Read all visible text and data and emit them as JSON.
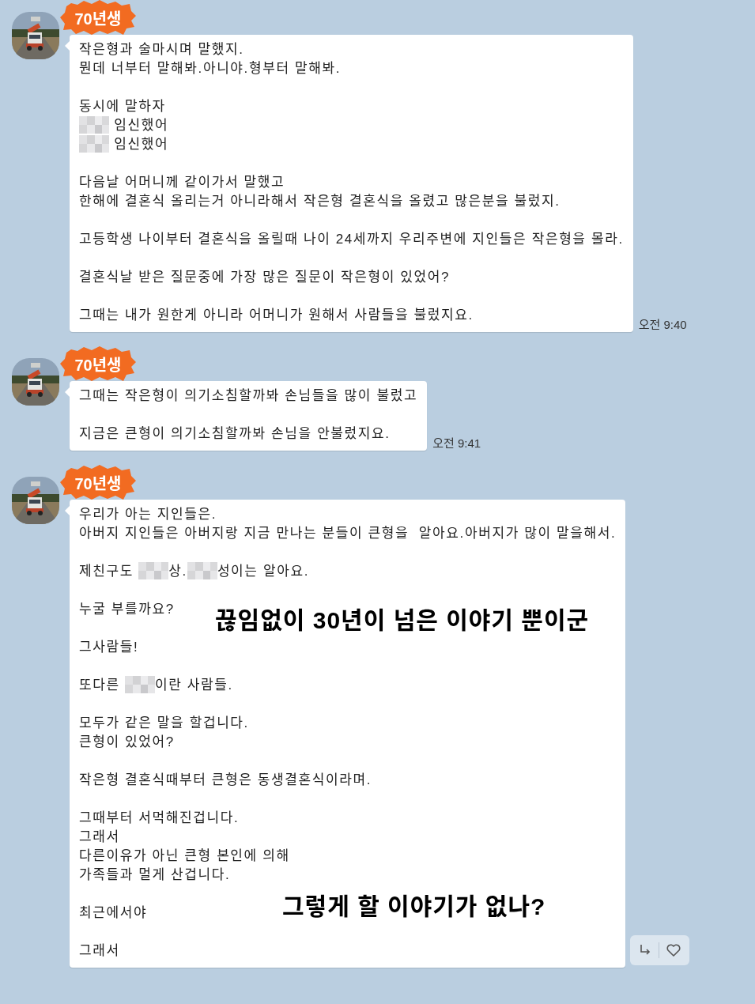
{
  "messages": [
    {
      "sender": "70년생",
      "time": "오전 9:40",
      "paragraphs": [
        [
          [
            {
              "kind": "text",
              "text": "작은형과 술마시며 말했지."
            }
          ],
          [
            {
              "kind": "text",
              "text": "뭔데 너부터 말해봐.아니야.형부터 말해봐."
            }
          ]
        ],
        [
          [
            {
              "kind": "text",
              "text": "동시에 말하자"
            }
          ],
          [
            {
              "kind": "mosaic"
            },
            {
              "kind": "text",
              "text": " 임신했어"
            }
          ],
          [
            {
              "kind": "mosaic"
            },
            {
              "kind": "text",
              "text": " 임신했어"
            }
          ]
        ],
        [
          [
            {
              "kind": "text",
              "text": "다음날 어머니께 같이가서 말했고"
            }
          ],
          [
            {
              "kind": "text",
              "text": "한해에 결혼식 올리는거 아니라해서 작은형 결혼식을 올렸고 많은분을 불렀지."
            }
          ]
        ],
        [
          [
            {
              "kind": "text",
              "text": "고등학생 나이부터 결혼식을 올릴때 나이 24세까지 우리주변에 지인들은 작은형을 몰라."
            }
          ]
        ],
        [
          [
            {
              "kind": "text",
              "text": "결혼식날 받은 질문중에 가장 많은 질문이 작은형이 있었어?"
            }
          ]
        ],
        [
          [
            {
              "kind": "text",
              "text": "그때는 내가 원한게 아니라 어머니가 원해서 사람들을 불렀지요."
            }
          ]
        ]
      ]
    },
    {
      "sender": "70년생",
      "time": "오전 9:41",
      "paragraphs": [
        [
          [
            {
              "kind": "text",
              "text": "그때는 작은형이 의기소침할까봐 손님들을 많이 불렀고"
            }
          ]
        ],
        [
          [
            {
              "kind": "text",
              "text": "지금은 큰형이 의기소침할까봐 손님을 안불렀지요."
            }
          ]
        ]
      ]
    },
    {
      "sender": "70년생",
      "paragraphs": [
        [
          [
            {
              "kind": "text",
              "text": "우리가 아는 지인들은."
            }
          ],
          [
            {
              "kind": "text",
              "text": "아버지 지인들은 아버지랑 지금 만나는 분들이 큰형을  알아요.아버지가 많이 말을해서."
            }
          ]
        ],
        [
          [
            {
              "kind": "text",
              "text": "제친구도 "
            },
            {
              "kind": "mosaic"
            },
            {
              "kind": "text",
              "text": "상."
            },
            {
              "kind": "mosaic"
            },
            {
              "kind": "text",
              "text": "성이는 알아요."
            }
          ]
        ],
        [
          [
            {
              "kind": "text",
              "text": "누굴 부를까요?"
            }
          ]
        ],
        [
          [
            {
              "kind": "text",
              "text": "그사람들!"
            }
          ]
        ],
        [
          [
            {
              "kind": "text",
              "text": "또다른 "
            },
            {
              "kind": "mosaic"
            },
            {
              "kind": "text",
              "text": "이란 사람들."
            }
          ]
        ],
        [
          [
            {
              "kind": "text",
              "text": "모두가 같은 말을 할겁니다."
            }
          ],
          [
            {
              "kind": "text",
              "text": "큰형이 있었어?"
            }
          ]
        ],
        [
          [
            {
              "kind": "text",
              "text": "작은형 결혼식때부터 큰형은 동생결혼식이라며."
            }
          ]
        ],
        [
          [
            {
              "kind": "text",
              "text": "그때부터 서먹해진겁니다."
            }
          ],
          [
            {
              "kind": "text",
              "text": "그래서"
            }
          ],
          [
            {
              "kind": "text",
              "text": "다른이유가 아닌 큰형 본인에 의해"
            }
          ],
          [
            {
              "kind": "text",
              "text": "가족들과 멀게 산겁니다."
            }
          ]
        ],
        [
          [
            {
              "kind": "text",
              "text": "최근에서야"
            }
          ]
        ],
        [
          [
            {
              "kind": "text",
              "text": "그래서"
            }
          ]
        ]
      ],
      "overlay_captions": [
        "끊임없이 30년이 넘은 이야기 뿐이군",
        "그렇게 할 이야기가 없나?"
      ],
      "reactions": true
    }
  ]
}
